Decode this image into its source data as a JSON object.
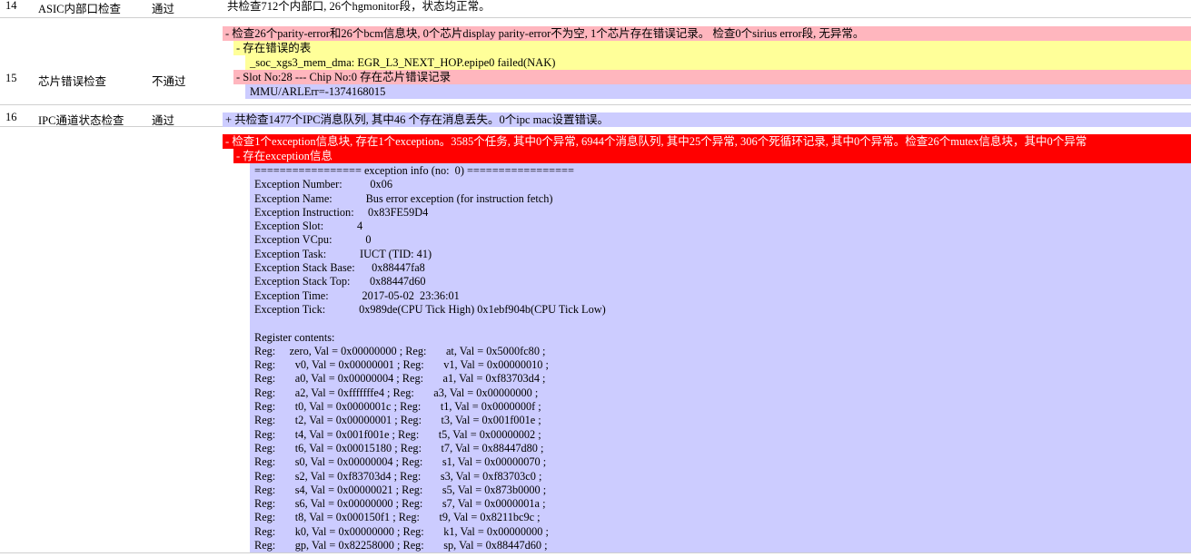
{
  "rows": [
    {
      "no": "14",
      "name": "ASIC内部口检查",
      "result": "通过",
      "summary": "共检查712个内部口, 26个hgmonitor段，状态均正常。"
    },
    {
      "no": "15",
      "name": "芯片错误检查",
      "result": "不通过",
      "summary": "- 检查26个parity-error和26个bcm信息块, 0个芯片display parity-error不为空, 1个芯片存在错误记录。 检查0个sirius error段, 无异常。",
      "sub1_title": "- 存在错误的表",
      "sub1_value": "_soc_xgs3_mem_dma: EGR_L3_NEXT_HOP.epipe0 failed(NAK)",
      "sub2_title": "- Slot No:28 --- Chip No:0 存在芯片错误记录",
      "sub2_value": "MMU/ARLErr=-1374168015"
    },
    {
      "no": "16",
      "name": "IPC通道状态检查",
      "result": "通过",
      "summary": "+ 共检查1477个IPC消息队列, 其中46 个存在消息丢失。0个ipc mac设置错误。"
    },
    {
      "summary": "- 检查1个exception信息块, 存在1个exception。3585个任务, 其中0个异常, 6944个消息队列, 其中25个异常, 306个死循环记录, 其中0个异常。检查26个mutex信息块，其中0个异常",
      "sub_title": "- 存在exception信息",
      "exception_lines": [
        "================= exception info (no:  0) =================",
        "Exception Number:          0x06",
        "Exception Name:            Bus error exception (for instruction fetch)",
        "Exception Instruction:     0x83FE59D4",
        "Exception Slot:            4",
        "Exception VCpu:            0",
        "Exception Task:            IUCT (TID: 41)",
        "Exception Stack Base:      0x88447fa8",
        "Exception Stack Top:       0x88447d60",
        "Exception Time:            2017-05-02  23:36:01",
        "Exception Tick:            0x989de(CPU Tick High) 0x1ebf904b(CPU Tick Low)",
        "",
        "Register contents:",
        "Reg:     zero, Val = 0x00000000 ; Reg:       at, Val = 0x5000fc80 ;",
        "Reg:       v0, Val = 0x00000001 ; Reg:       v1, Val = 0x00000010 ;",
        "Reg:       a0, Val = 0x00000004 ; Reg:       a1, Val = 0xf83703d4 ;",
        "Reg:       a2, Val = 0xfffffffe4 ; Reg:       a3, Val = 0x00000000 ;",
        "Reg:       t0, Val = 0x0000001c ; Reg:       t1, Val = 0x0000000f ;",
        "Reg:       t2, Val = 0x00000001 ; Reg:       t3, Val = 0x001f001e ;",
        "Reg:       t4, Val = 0x001f001e ; Reg:       t5, Val = 0x00000002 ;",
        "Reg:       t6, Val = 0x00015180 ; Reg:       t7, Val = 0x88447d80 ;",
        "Reg:       s0, Val = 0x00000004 ; Reg:       s1, Val = 0x00000070 ;",
        "Reg:       s2, Val = 0xf83703d4 ; Reg:       s3, Val = 0xf83703c0 ;",
        "Reg:       s4, Val = 0x00000021 ; Reg:       s5, Val = 0x873b0000 ;",
        "Reg:       s6, Val = 0x00000000 ; Reg:       s7, Val = 0x0000001a ;",
        "Reg:       t8, Val = 0x000150f1 ; Reg:       t9, Val = 0x8211bc9c ;",
        "Reg:       k0, Val = 0x00000000 ; Reg:       k1, Val = 0x00000000 ;",
        "Reg:       gp, Val = 0x82258000 ; Reg:       sp, Val = 0x88447d60 ;"
      ]
    }
  ],
  "colors": {
    "error_pink": "#ffb6be",
    "table_yellow": "#ffff99",
    "info_lavender": "#ccccff",
    "critical_red": "#ff0000"
  }
}
